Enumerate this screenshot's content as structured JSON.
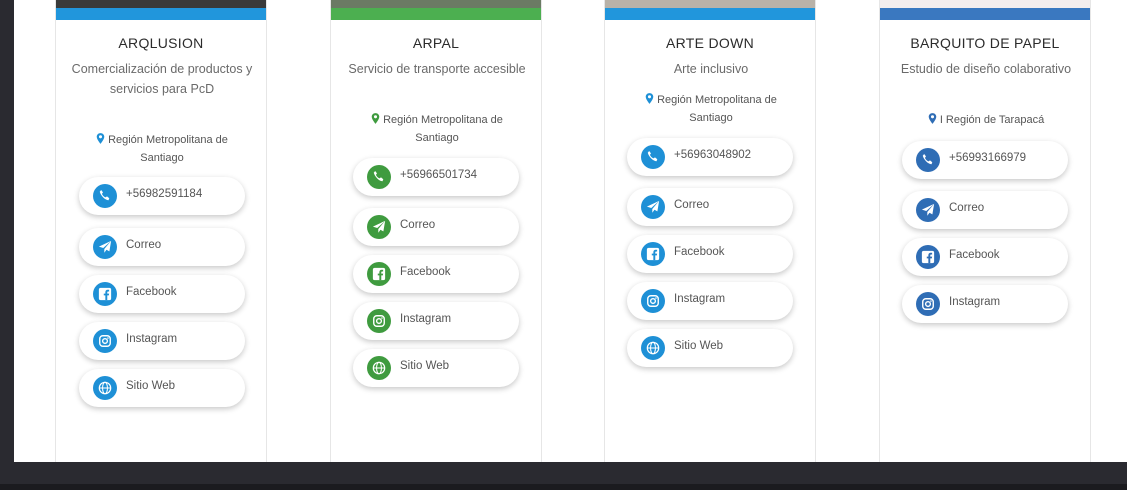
{
  "cards": [
    {
      "name": "ARQLUSION",
      "description": "Comercialización de productos y servicios para PcD",
      "region": "Región Metropolitana de Santiago",
      "phone": "+56982591184",
      "links": [
        "Correo",
        "Facebook",
        "Instagram",
        "Sitio Web"
      ],
      "accent": "#1e90d6",
      "band": "#2196dc"
    },
    {
      "name": "ARPAL",
      "description": "Servicio de transporte accesible",
      "region": "Región Metropolitana de Santiago",
      "phone": "+56966501734",
      "links": [
        "Correo",
        "Facebook",
        "Instagram",
        "Sitio Web"
      ],
      "accent": "#3f9b3f",
      "band": "#4caf50"
    },
    {
      "name": "ARTE DOWN",
      "description": "Arte inclusivo",
      "region": "Región Metropolitana de Santiago",
      "phone": "+56963048902",
      "links": [
        "Correo",
        "Facebook",
        "Instagram",
        "Sitio Web"
      ],
      "accent": "#1e90d6",
      "band": "#2196dc"
    },
    {
      "name": "BARQUITO DE PAPEL",
      "description": "Estudio de diseño colaborativo",
      "region": "I Región de Tarapacá",
      "phone": "+56993166979",
      "links": [
        "Correo",
        "Facebook",
        "Instagram"
      ],
      "accent": "#2f6db5",
      "band": "#3a78c0"
    }
  ],
  "icons": {
    "phone": "phone-icon",
    "Correo": "send-icon",
    "Facebook": "facebook-icon",
    "Instagram": "instagram-icon",
    "Sitio Web": "globe-icon",
    "region": "map-pin-icon"
  }
}
